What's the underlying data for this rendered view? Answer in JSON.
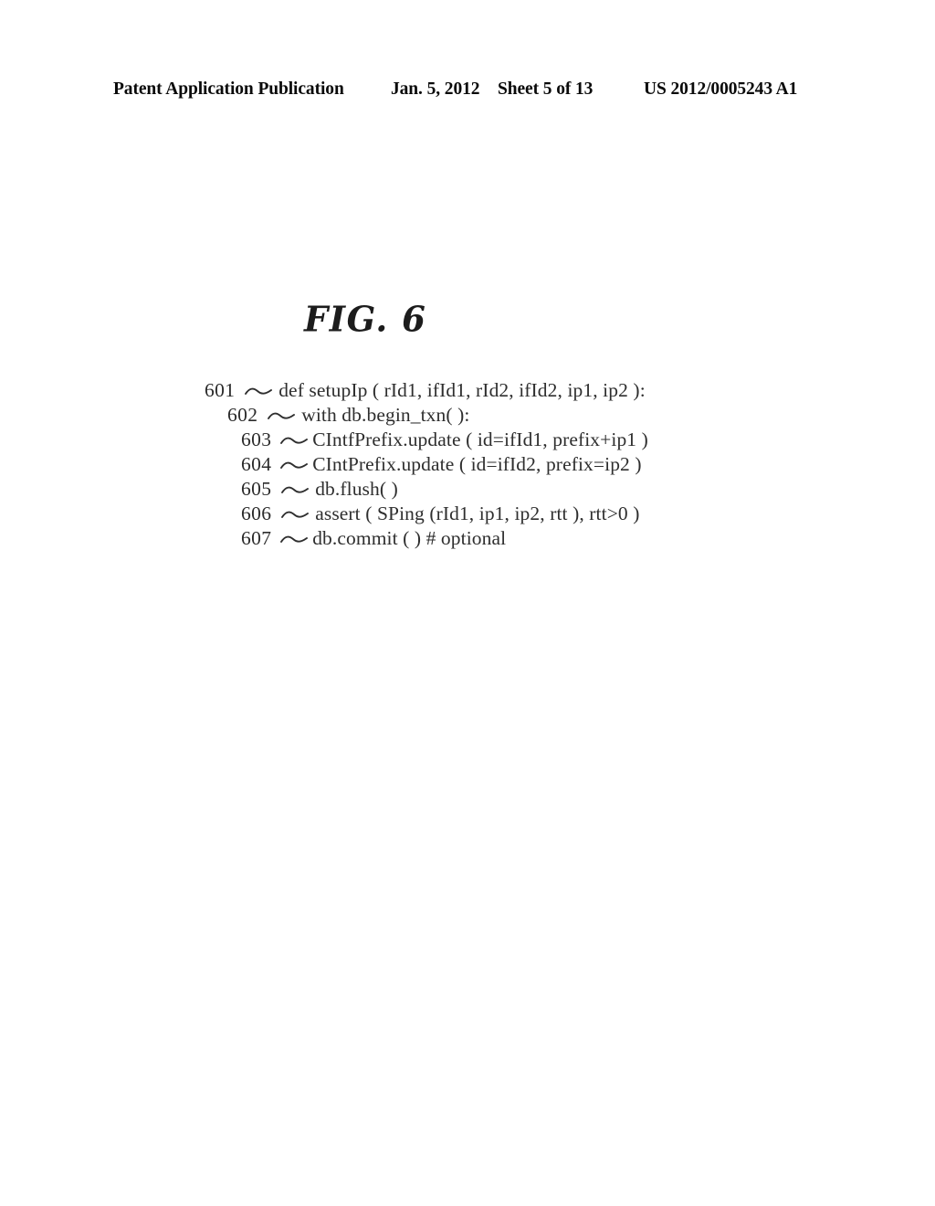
{
  "document": {
    "kind": "patent-application-publication-drawing-sheet",
    "header": {
      "publication_label": "Patent Application Publication",
      "date": "Jan. 5, 2012",
      "sheet": "Sheet 5 of 13",
      "publication_number": "US 2012/0005243 A1"
    }
  },
  "figure": {
    "label": "FIG. 6",
    "code_lines": [
      {
        "ref": "601",
        "text": "def setupIp ( rId1, ifId1, rId2, ifId2, ip1, ip2 ):"
      },
      {
        "ref": "602",
        "text": "with db.begin_txn( ):"
      },
      {
        "ref": "603",
        "text": "CIntfPrefix.update ( id=ifId1, prefix+ip1 )"
      },
      {
        "ref": "604",
        "text": "CIntPrefix.update ( id=ifId2, prefix=ip2 )"
      },
      {
        "ref": "605",
        "text": "db.flush( )"
      },
      {
        "ref": "606",
        "text": "assert ( SPing (rId1, ip1, ip2, rtt ), rtt>0 )"
      },
      {
        "ref": "607",
        "text": "db.commit ( ) # optional"
      }
    ],
    "leader_icon": "wave-leader-line-icon"
  },
  "colors": {
    "page_background": "#ffffff",
    "header_text": "#0a0a0a",
    "code_text": "#2e2e2e",
    "figure_label_text": "#1c1c1c"
  }
}
